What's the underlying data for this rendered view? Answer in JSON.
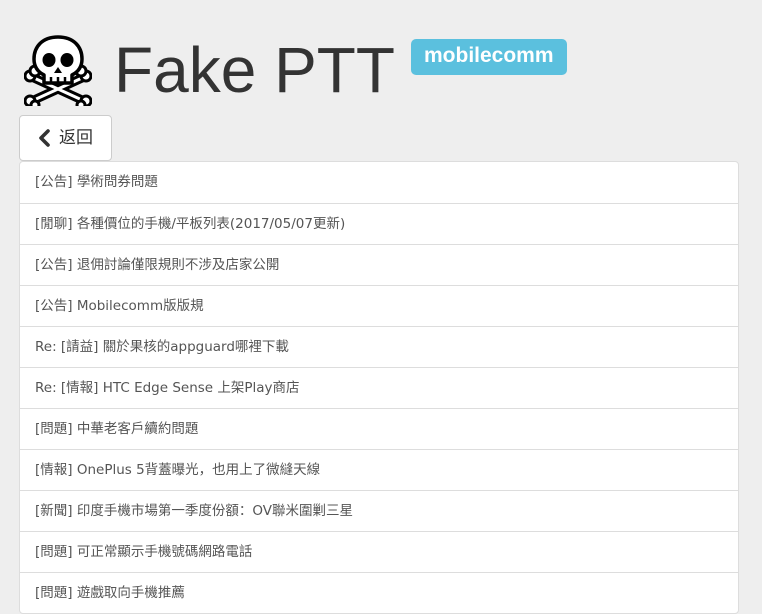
{
  "header": {
    "icon": "skull-and-crossbones-icon",
    "title": "Fake PTT",
    "board_badge": "mobilecomm",
    "badge_color": "#5bc0de"
  },
  "nav": {
    "back_icon": "chevron-left-icon",
    "back_label": "返回"
  },
  "posts": [
    {
      "title": "[公告] 學術問券問題"
    },
    {
      "title": "[閒聊] 各種價位的手機/平板列表(2017/05/07更新)"
    },
    {
      "title": "[公告] 退佣討論僅限規則不涉及店家公開"
    },
    {
      "title": "[公告] Mobilecomm版版規"
    },
    {
      "title": "Re: [請益] 關於果核的appguard哪裡下載"
    },
    {
      "title": "Re: [情報] HTC Edge Sense 上架Play商店"
    },
    {
      "title": "[問題] 中華老客戶續約問題"
    },
    {
      "title": "[情報] OnePlus 5背蓋曝光，也用上了微縫天線"
    },
    {
      "title": "[新聞] 印度手機市場第一季度份額：OV聯米圍剿三星"
    },
    {
      "title": "[問題] 可正常顯示手機號碼網路電話"
    },
    {
      "title": "[問題] 遊戲取向手機推薦"
    }
  ]
}
